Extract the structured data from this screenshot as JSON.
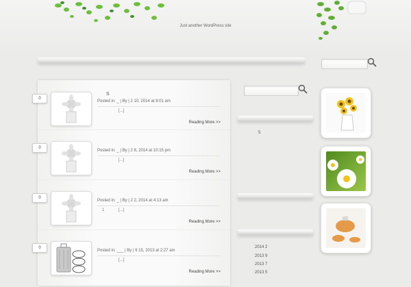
{
  "site": {
    "tagline": "Just another WordPress site"
  },
  "search": {
    "value": "",
    "sidebar_value": ""
  },
  "posts": [
    {
      "comments": "0",
      "title": "S",
      "posted_in": "Posted in: _",
      "by": "|  By",
      "date": "|  2  10, 2014 at 8:01 am",
      "excerpt_num": "",
      "excerpt": "[...]",
      "more": "Reading More >>"
    },
    {
      "comments": "0",
      "title": "",
      "posted_in": "Posted in: _",
      "by": "|  By",
      "date": "|  2  8, 2014 at 10:15 pm",
      "excerpt_num": "",
      "excerpt": "[...]",
      "more": "Reading More >>"
    },
    {
      "comments": "0",
      "title": "",
      "posted_in": "Posted in: _",
      "by": "|  By",
      "date": "|  2  2, 2014 at 4:13 am",
      "excerpt_num": "1",
      "excerpt": "[...]",
      "more": "Reading More >>"
    },
    {
      "comments": "0",
      "title": "",
      "posted_in": "Posted in: ___",
      "by": "|  By",
      "date": "|  9  15, 2013 at 2:27 am",
      "excerpt_num": "",
      "excerpt": "[...]",
      "more": "Reading More >>"
    }
  ],
  "sidebar": {
    "count": "5",
    "archives": [
      "2014 2",
      "2013 9",
      "2013 7",
      "2013 5"
    ]
  },
  "photos": [
    "sunflower-vase",
    "daisies",
    "tea-pot"
  ]
}
